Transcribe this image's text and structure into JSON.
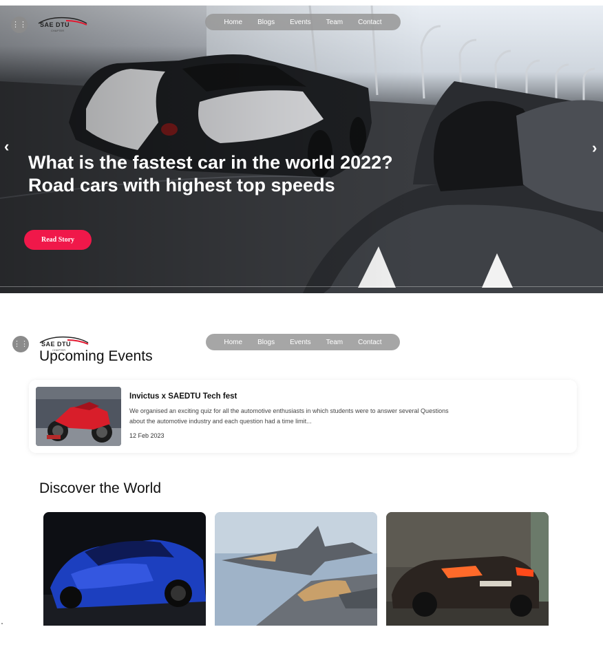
{
  "brand": {
    "logo_text": "SAE DTU",
    "logo_sub": "CHAPTER"
  },
  "nav": [
    "Home",
    "Blogs",
    "Events",
    "Team",
    "Contact"
  ],
  "hero": {
    "headline": "What is the fastest car in the world 2022? Road cars with highest top speeds",
    "cta_label": "Read Story",
    "prev_arrow": "‹",
    "next_arrow": "›"
  },
  "events_section": {
    "title": "Upcoming Events",
    "events": [
      {
        "title": "Invictus x SAEDTU Tech fest",
        "description": "We organised an exciting quiz for all the automotive enthusiasts in which students were to answer several Questions about the automotive industry and each question had a time limit...",
        "date": "12 Feb 2023"
      }
    ]
  },
  "discover_section": {
    "title": "Discover the World"
  },
  "colors": {
    "accent": "#f0184a",
    "nav_bg": "#969696"
  },
  "icons": [
    "grid-menu-icon",
    "chevron-left-icon",
    "chevron-right-icon"
  ]
}
